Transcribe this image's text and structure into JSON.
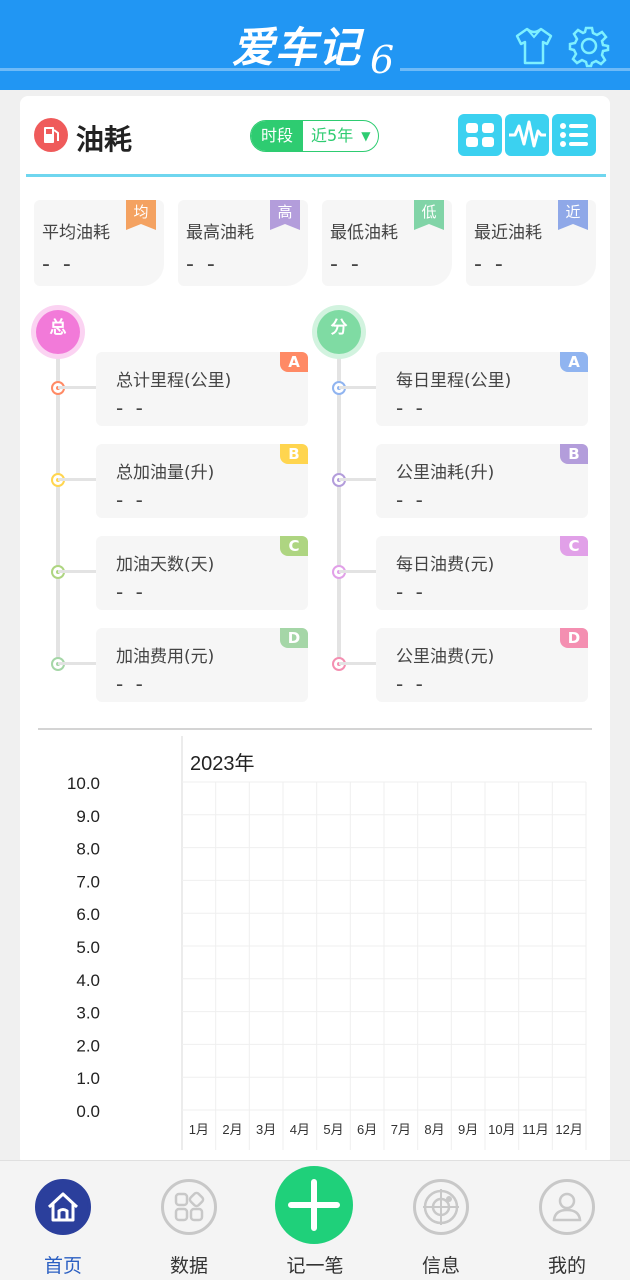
{
  "app": {
    "title": "爱车记",
    "version": "6"
  },
  "header": {
    "icons": [
      "shirt-icon",
      "gear-icon"
    ]
  },
  "section": {
    "title": "油耗",
    "period_label": "时段",
    "period_value": "近5年",
    "tools": [
      "grid-icon",
      "wave-icon",
      "list-icon"
    ]
  },
  "stats": [
    {
      "label": "平均油耗",
      "value": "- -",
      "badge": "均",
      "color": "#f4a261"
    },
    {
      "label": "最高油耗",
      "value": "- -",
      "badge": "高",
      "color": "#b39ddb"
    },
    {
      "label": "最低油耗",
      "value": "- -",
      "badge": "低",
      "color": "#81d4a7"
    },
    {
      "label": "最近油耗",
      "value": "- -",
      "badge": "近",
      "color": "#8fa8e8"
    }
  ],
  "total": {
    "label": "总",
    "items": [
      {
        "label": "总计里程(公里)",
        "value": "- -",
        "badge": "A",
        "color": "#ff8a65"
      },
      {
        "label": "总加油量(升)",
        "value": "- -",
        "badge": "B",
        "color": "#ffd54f"
      },
      {
        "label": "加油天数(天)",
        "value": "- -",
        "badge": "C",
        "color": "#aed581"
      },
      {
        "label": "加油费用(元)",
        "value": "- -",
        "badge": "D",
        "color": "#a5d6a7"
      }
    ]
  },
  "per": {
    "label": "分",
    "items": [
      {
        "label": "每日里程(公里)",
        "value": "- -",
        "badge": "A",
        "color": "#90b4f0"
      },
      {
        "label": "公里油耗(升)",
        "value": "- -",
        "badge": "B",
        "color": "#b39ddb"
      },
      {
        "label": "每日油费(元)",
        "value": "- -",
        "badge": "C",
        "color": "#e1a0e8"
      },
      {
        "label": "公里油费(元)",
        "value": "- -",
        "badge": "D",
        "color": "#f48fb1"
      }
    ]
  },
  "chart_data": {
    "type": "bar",
    "title": "2023年",
    "categories": [
      "1月",
      "2月",
      "3月",
      "4月",
      "5月",
      "6月",
      "7月",
      "8月",
      "9月",
      "10月",
      "11月",
      "12月"
    ],
    "values": [],
    "ylim": [
      0,
      10
    ],
    "yticks": [
      "0.0",
      "1.0",
      "2.0",
      "3.0",
      "4.0",
      "5.0",
      "6.0",
      "7.0",
      "8.0",
      "9.0",
      "10.0"
    ],
    "grid": true
  },
  "nav": [
    {
      "label": "首页",
      "icon": "home-icon",
      "active": true
    },
    {
      "label": "数据",
      "icon": "data-icon",
      "active": false
    },
    {
      "label": "记一笔",
      "icon": "plus-icon",
      "active": false
    },
    {
      "label": "信息",
      "icon": "radar-icon",
      "active": false
    },
    {
      "label": "我的",
      "icon": "user-icon",
      "active": false
    }
  ],
  "colors": {
    "primary": "#2196f3",
    "accent": "#2ecc71",
    "fab": "#1fd07a",
    "nav_active": "#2b5fc2"
  }
}
